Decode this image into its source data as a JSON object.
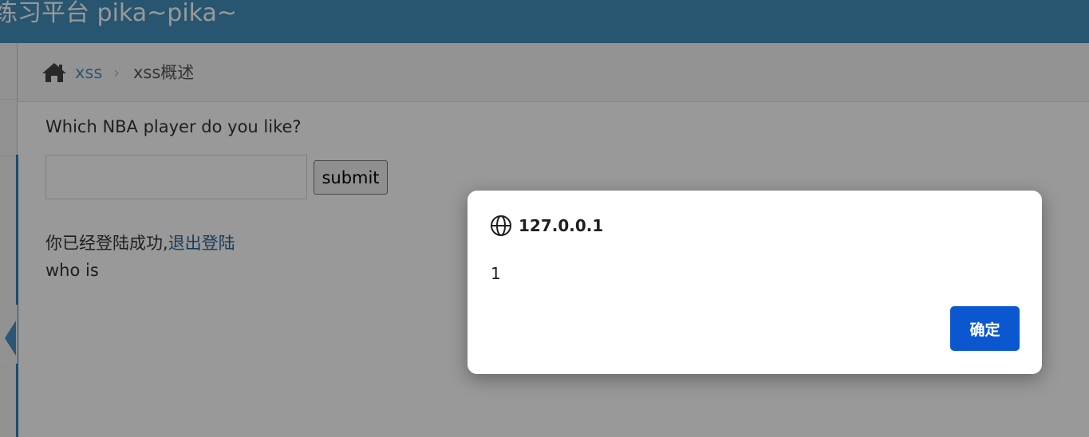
{
  "header": {
    "title": "练习平台 pika~pika~"
  },
  "breadcrumb": {
    "link_label": "xss",
    "separator": "›",
    "current": "xss概述"
  },
  "form": {
    "question": "Which NBA player do you like?",
    "input_value": "",
    "submit_label": "submit"
  },
  "status": {
    "login_text": "你已经登陆成功,",
    "logout_label": "退出登陆",
    "result_text": "who is"
  },
  "dialog": {
    "origin": "127.0.0.1",
    "message": "1",
    "ok_label": "确定"
  },
  "colors": {
    "header_bg": "#438eb9",
    "link": "#4c8fbd",
    "dialog_button": "#0b57d0"
  },
  "icons": {
    "home": "home-icon",
    "globe": "globe-icon",
    "collapse": "collapse-arrow-icon"
  }
}
